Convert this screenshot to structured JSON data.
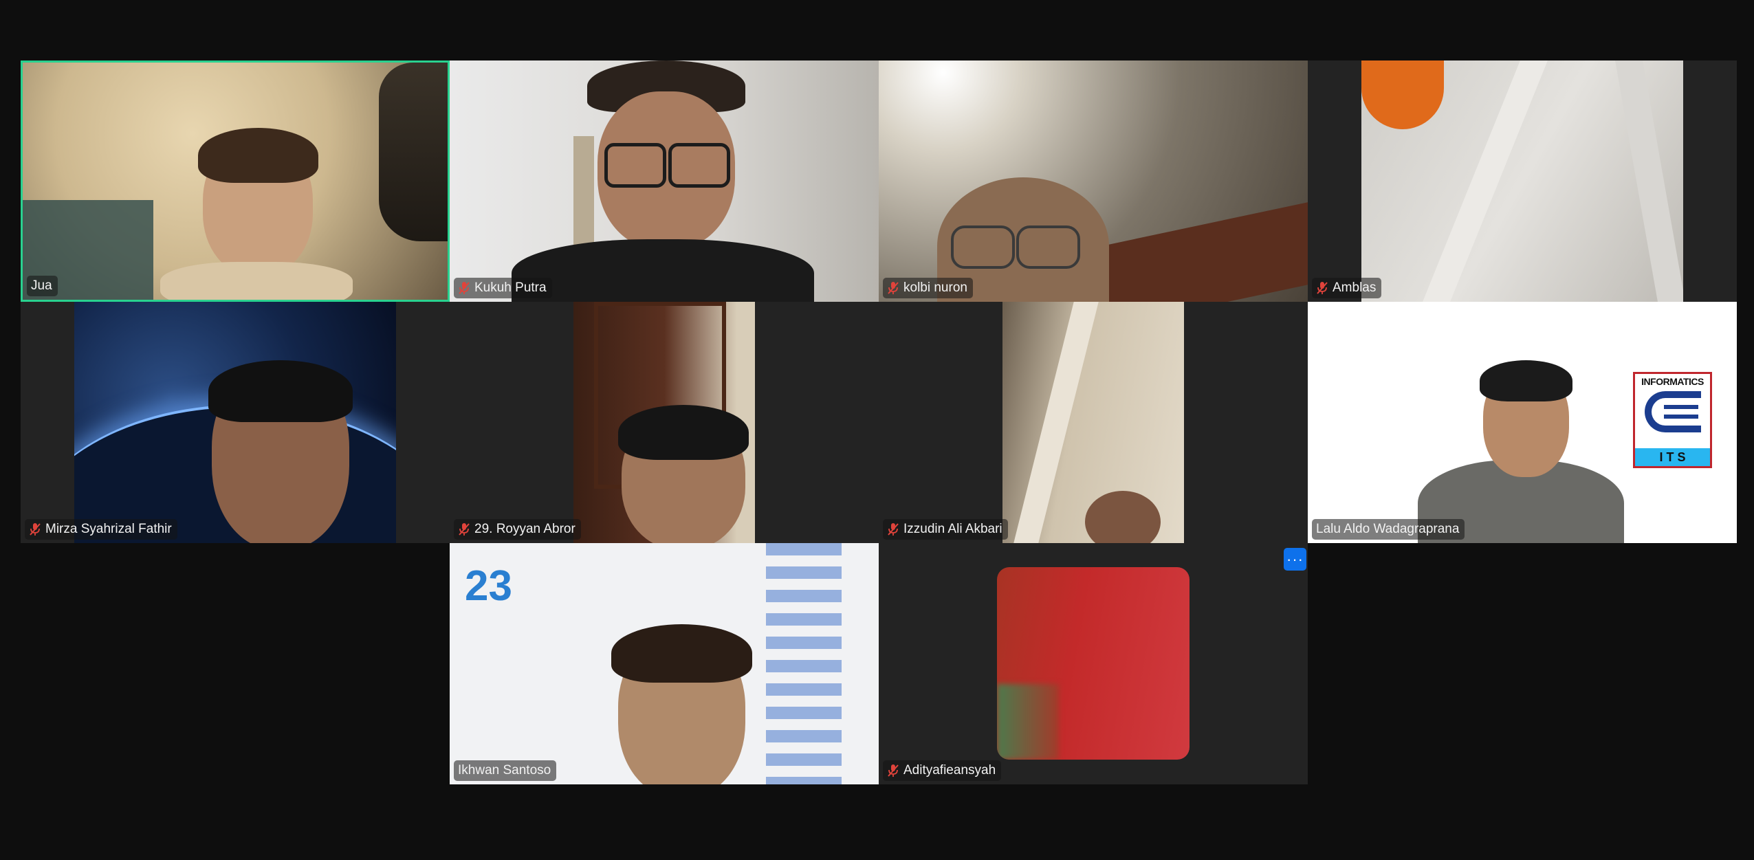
{
  "participants": [
    {
      "name": "Jua",
      "muted": false,
      "speaking": true
    },
    {
      "name": "Kukuh Putra",
      "muted": true
    },
    {
      "name": "kolbi nuron",
      "muted": true
    },
    {
      "name": "Amblas",
      "muted": true
    },
    {
      "name": "Mirza Syahrizal Fathir",
      "muted": true
    },
    {
      "name": "29. Royyan Abror",
      "muted": true
    },
    {
      "name": "Izzudin Ali Akbari",
      "muted": true
    },
    {
      "name": "Lalu Aldo Wadagraprana",
      "muted": false
    },
    {
      "name": "Ikhwan Santoso",
      "muted": false
    },
    {
      "name": "Adityafieansyah",
      "muted": true
    }
  ],
  "more_options": {
    "label": "···"
  },
  "logo": {
    "top_text": "INFORMATICS",
    "bottom_text": "I T S"
  },
  "colors": {
    "background": "#0e0e0e",
    "tile_background": "#232323",
    "active_speaker_border": "#29d18f",
    "muted_icon": "#e0433b",
    "more_button": "#0e71eb"
  }
}
